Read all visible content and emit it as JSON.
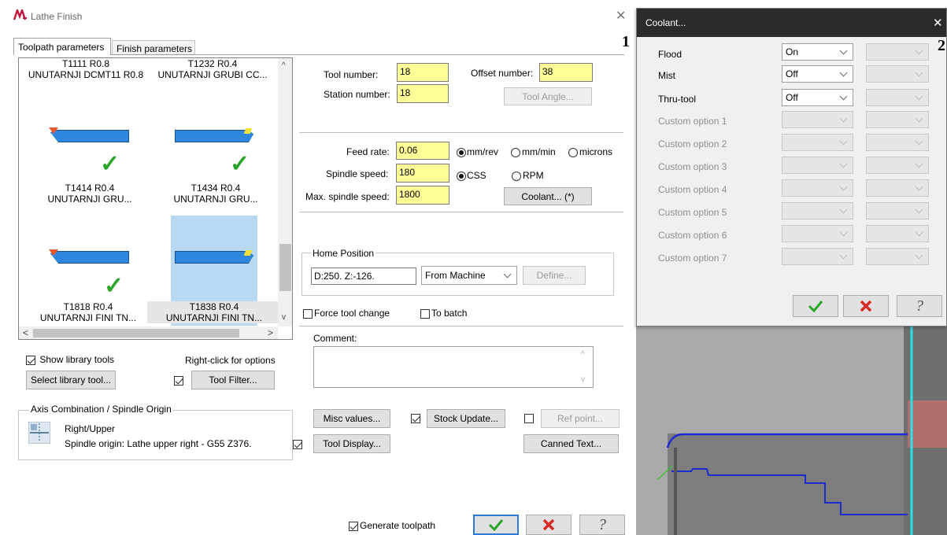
{
  "markers": {
    "one": "1",
    "two": "2"
  },
  "window": {
    "title": "Lathe Finish",
    "close_glyph": "✕"
  },
  "tabs": [
    {
      "label": "Toolpath parameters"
    },
    {
      "label": "Finish parameters"
    }
  ],
  "tools": [
    {
      "line1": "T1111 R0.8",
      "line2": "UNUTARNJI DCMT11 R0.8"
    },
    {
      "line1": "T1232 R0.4",
      "line2": "UNUTARNJI GRUBI CC..."
    },
    {
      "line1": "T1414 R0.4",
      "line2": "UNUTARNJI GRU..."
    },
    {
      "line1": "T1434 R0.4",
      "line2": "UNUTARNJI GRU..."
    },
    {
      "line1": "T1818 R0.4",
      "line2": "UNUTARNJI FINI TN..."
    },
    {
      "line1": "T1838 R0.4",
      "line2": "UNUTARNJI FINI TN..."
    }
  ],
  "library": {
    "show_label": "Show library tools",
    "hint": "Right-click for options",
    "select_btn": "Select library tool...",
    "filter_btn": "Tool Filter..."
  },
  "axis": {
    "group_label": "Axis Combination / Spindle Origin",
    "combo": "Right/Upper",
    "origin": "Spindle origin: Lathe upper right - G55   Z376."
  },
  "params": {
    "tool_number_label": "Tool number:",
    "tool_number": "18",
    "offset_number_label": "Offset number:",
    "offset_number": "38",
    "station_number_label": "Station number:",
    "station_number": "18",
    "tool_angle_btn": "Tool Angle...",
    "feed_rate_label": "Feed rate:",
    "feed_rate": "0.06",
    "unit_mmrev": "mm/rev",
    "unit_mmmin": "mm/min",
    "unit_microns": "microns",
    "spindle_label": "Spindle speed:",
    "spindle_speed": "180",
    "css_label": "CSS",
    "rpm_label": "RPM",
    "max_spindle_label": "Max. spindle speed:",
    "max_spindle": "1800",
    "coolant_btn": "Coolant... (*)",
    "home_label": "Home Position",
    "home_value": "D:250.  Z:-126.",
    "home_source": "From Machine",
    "define_btn": "Define...",
    "force_label": "Force tool change",
    "batch_label": "To batch",
    "comment_label": "Comment:",
    "misc_btn": "Misc values...",
    "stock_btn": "Stock Update...",
    "ref_btn": "Ref point...",
    "tool_display_btn": "Tool Display...",
    "canned_btn": "Canned Text..."
  },
  "bottom": {
    "generate_label": "Generate toolpath",
    "help_glyph": "?"
  },
  "coolant": {
    "title": "Coolant...",
    "close_glyph": "✕",
    "rows": [
      {
        "label": "Flood",
        "value": "On"
      },
      {
        "label": "Mist",
        "value": "Off"
      },
      {
        "label": "Thru-tool",
        "value": "Off"
      },
      {
        "label": "Custom option 1",
        "value": ""
      },
      {
        "label": "Custom option 2",
        "value": ""
      },
      {
        "label": "Custom option 3",
        "value": ""
      },
      {
        "label": "Custom option 4",
        "value": ""
      },
      {
        "label": "Custom option 5",
        "value": ""
      },
      {
        "label": "Custom option 6",
        "value": ""
      },
      {
        "label": "Custom option 7",
        "value": ""
      }
    ],
    "help_glyph": "?"
  },
  "colors": {
    "accept": "#2aa52a",
    "cancel": "#d62a2a",
    "input_bg": "#ffff99",
    "tool_blue": "#2e86de",
    "selected_tile": "#b9d9f2",
    "titlebar_dark": "#2b2b2b",
    "viewport_gray": "#888888"
  }
}
